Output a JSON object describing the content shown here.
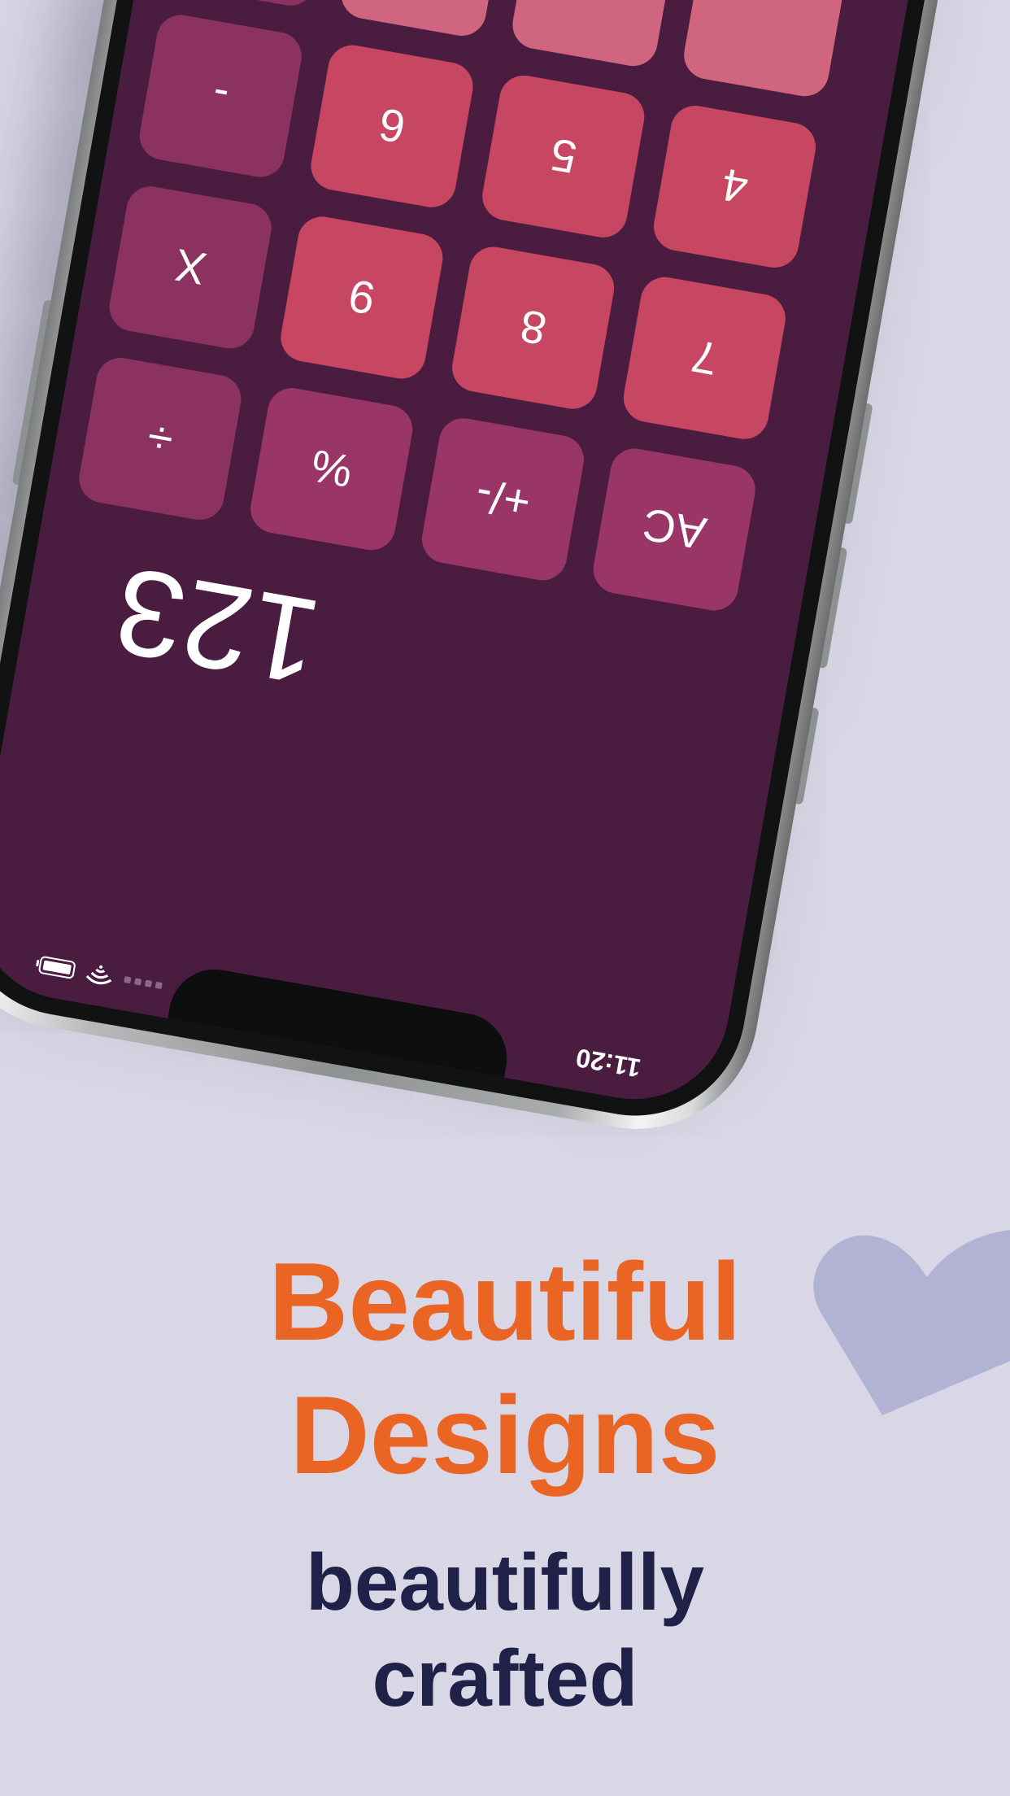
{
  "status_bar": {
    "time": "11:20"
  },
  "calculator": {
    "display_value": "123",
    "keys": [
      {
        "label": "AC",
        "kind": "fn",
        "name": "all-clear-key"
      },
      {
        "label": "+/-",
        "kind": "fn",
        "name": "plus-minus-key"
      },
      {
        "label": "%",
        "kind": "fn",
        "name": "percent-key"
      },
      {
        "label": "÷",
        "kind": "op",
        "name": "divide-key"
      },
      {
        "label": "7",
        "kind": "num",
        "name": "digit-7-key"
      },
      {
        "label": "8",
        "kind": "num",
        "name": "digit-8-key"
      },
      {
        "label": "9",
        "kind": "num",
        "name": "digit-9-key"
      },
      {
        "label": "X",
        "kind": "op",
        "name": "multiply-key"
      },
      {
        "label": "4",
        "kind": "num",
        "name": "digit-4-key"
      },
      {
        "label": "5",
        "kind": "num",
        "name": "digit-5-key"
      },
      {
        "label": "6",
        "kind": "num",
        "name": "digit-6-key"
      },
      {
        "label": "-",
        "kind": "op",
        "name": "minus-key"
      }
    ]
  },
  "headline": {
    "line1": "Beautiful",
    "line2": "Designs"
  },
  "subhead": {
    "line1": "beautifully",
    "line2": "crafted"
  },
  "colors": {
    "background": "#d9d7e5",
    "screen": "#4a1c40",
    "headline": "#ea6424",
    "subhead": "#1f2148",
    "heart": "#b2b2d5"
  }
}
